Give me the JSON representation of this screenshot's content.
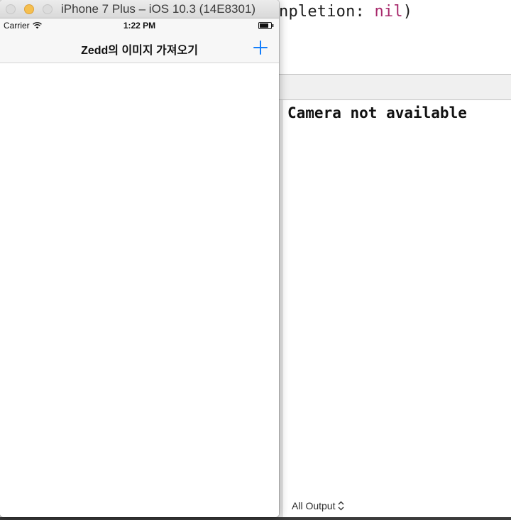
{
  "xcode": {
    "code": {
      "prefix": "npletion: ",
      "keyword": "nil",
      "suffix": ")"
    },
    "console": {
      "output": "Camera not available",
      "filter_label": "All Output"
    }
  },
  "simulator": {
    "window_title": "iPhone 7 Plus – iOS 10.3 (14E8301)",
    "status_bar": {
      "carrier": "Carrier",
      "time": "1:22 PM"
    },
    "nav_bar": {
      "title": "Zedd의 이미지 가져오기",
      "add_icon": "plus-icon"
    }
  },
  "colors": {
    "keyword": "#a82a6c",
    "ios_tint": "#147efb",
    "minimize_button": "#f5bf4f"
  }
}
